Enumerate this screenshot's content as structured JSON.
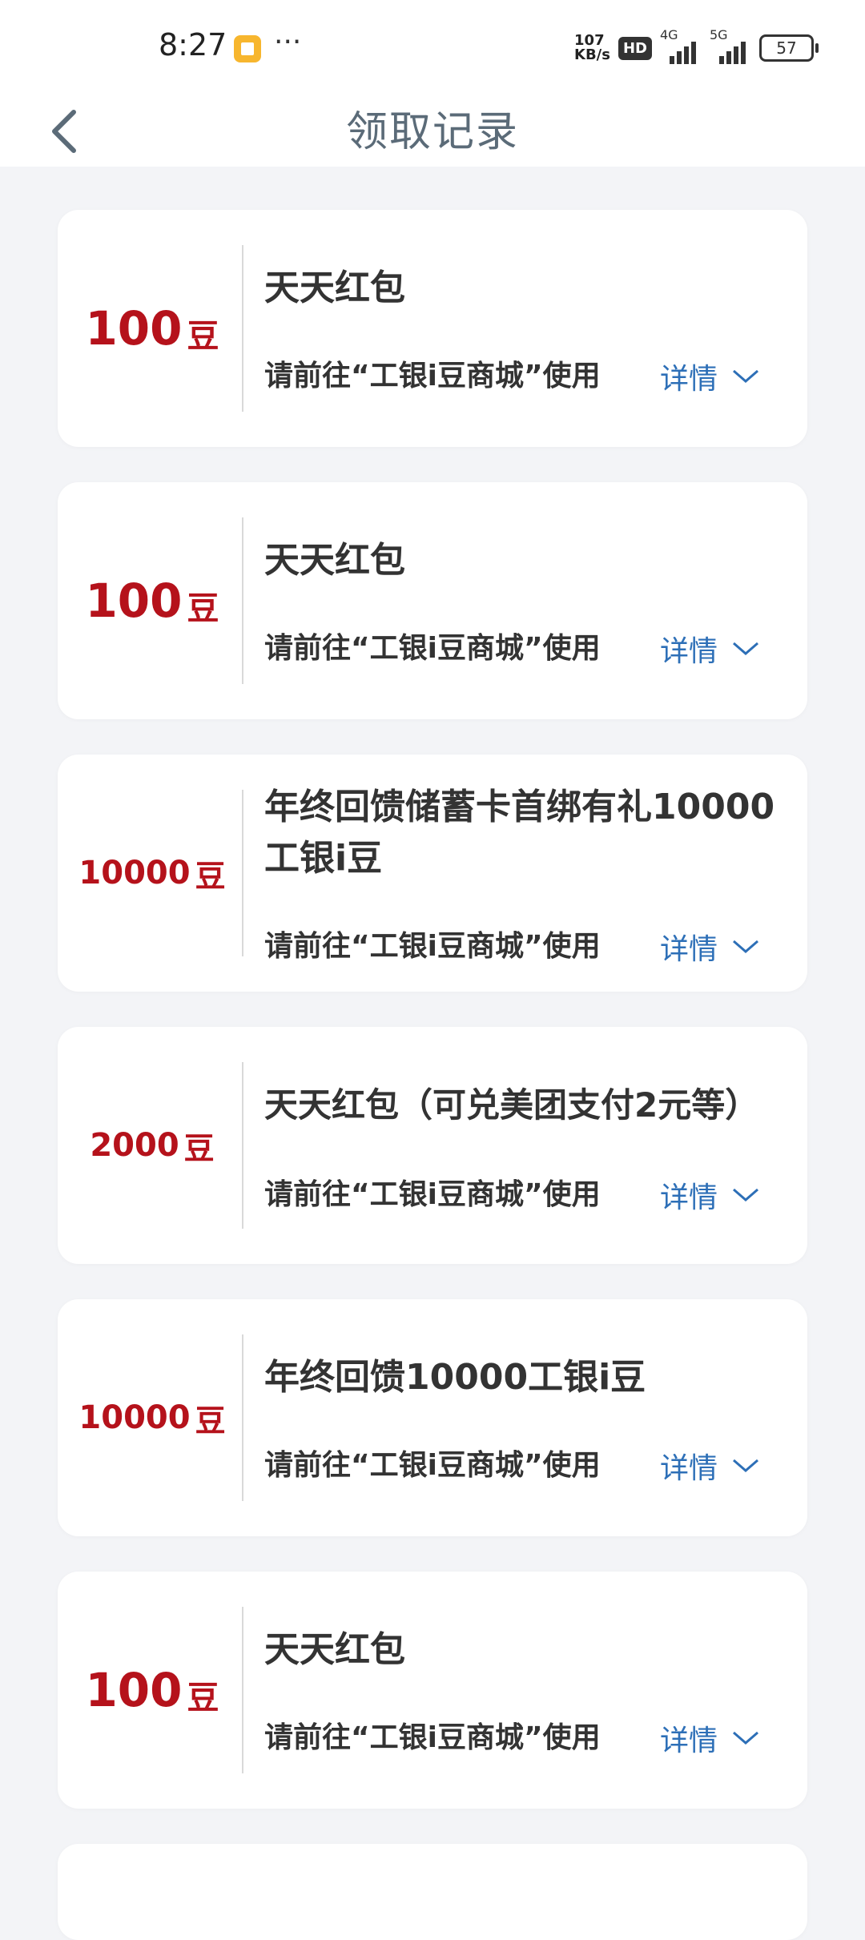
{
  "status_bar": {
    "time": "8:27",
    "more": "···",
    "net_speed_value": "107",
    "net_speed_unit": "KB/s",
    "hd": "HD",
    "signal_4g": "4G",
    "signal_5g": "5G",
    "battery": "57"
  },
  "header": {
    "title": "领取记录"
  },
  "records": [
    {
      "amount": "100",
      "unit": "豆",
      "title": "天天红包",
      "desc": "请前往“工银i豆商城”使用",
      "detail": "详情"
    },
    {
      "amount": "100",
      "unit": "豆",
      "title": "天天红包",
      "desc": "请前往“工银i豆商城”使用",
      "detail": "详情"
    },
    {
      "amount": "10000",
      "unit": "豆",
      "title": "年终回馈储蓄卡首绑有礼10000工银i豆",
      "desc": "请前往“工银i豆商城”使用",
      "detail": "详情"
    },
    {
      "amount": "2000",
      "unit": "豆",
      "title": "天天红包（可兑美团支付2元等）",
      "desc": "请前往“工银i豆商城”使用",
      "detail": "详情"
    },
    {
      "amount": "10000",
      "unit": "豆",
      "title": "年终回馈10000工银i豆",
      "desc": "请前往“工银i豆商城”使用",
      "detail": "详情"
    },
    {
      "amount": "100",
      "unit": "豆",
      "title": "天天红包",
      "desc": "请前往“工银i豆商城”使用",
      "detail": "详情"
    }
  ],
  "colors": {
    "amount_red": "#b5121b",
    "detail_blue": "#2d6fb7",
    "title_gray": "#5b6b78"
  }
}
